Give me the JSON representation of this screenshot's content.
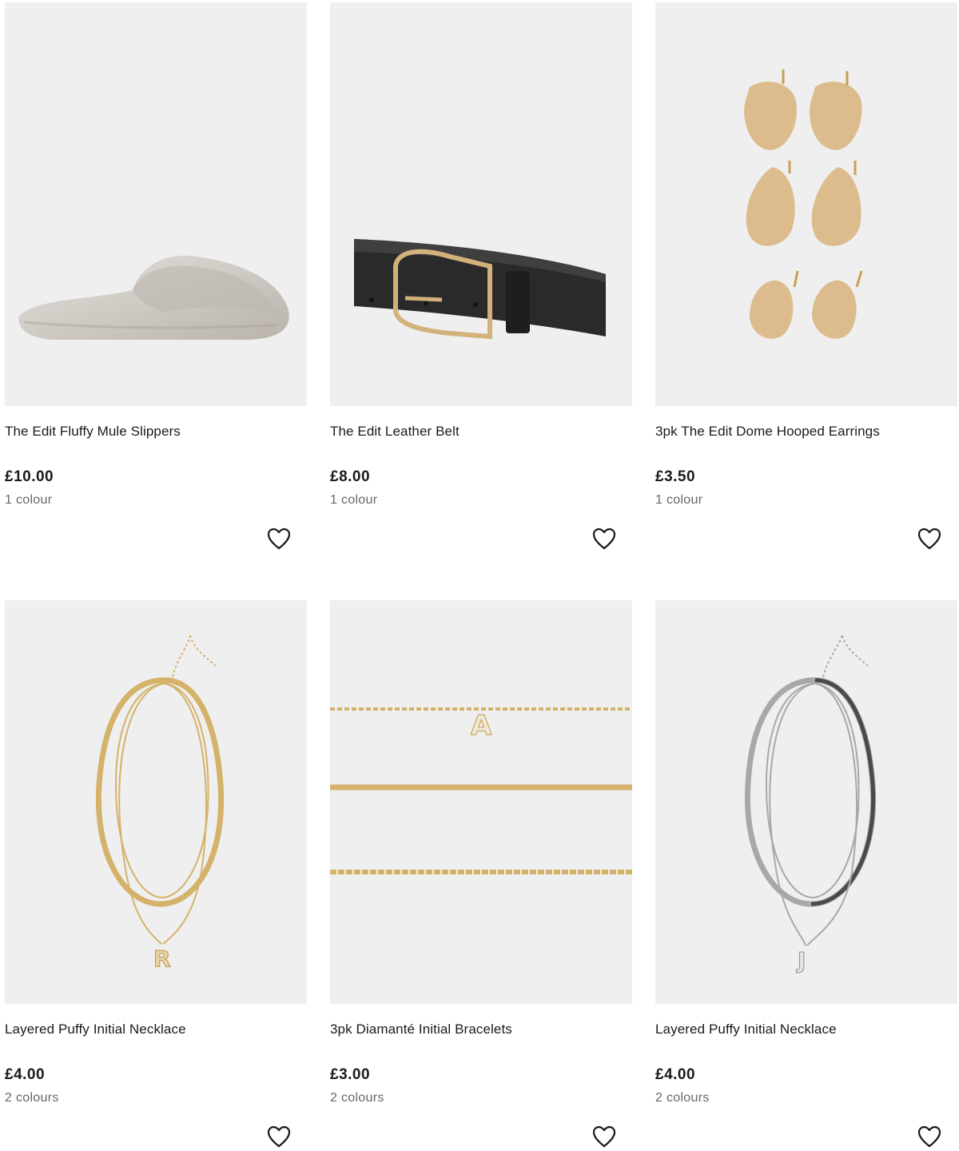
{
  "products": [
    {
      "name": "The Edit Fluffy Mule Slippers",
      "price": "£10.00",
      "colours": "1 colour",
      "image": "fluffy-slipper"
    },
    {
      "name": "The Edit Leather Belt",
      "price": "£8.00",
      "colours": "1 colour",
      "image": "leather-belt"
    },
    {
      "name": "3pk The Edit Dome Hooped Earrings",
      "price": "£3.50",
      "colours": "1 colour",
      "image": "dome-earrings"
    },
    {
      "name": "Layered Puffy Initial Necklace",
      "price": "£4.00",
      "colours": "2 colours",
      "image": "gold-necklace-r"
    },
    {
      "name": "3pk Diamanté Initial Bracelets",
      "price": "£3.00",
      "colours": "2 colours",
      "image": "gold-bracelets"
    },
    {
      "name": "Layered Puffy Initial Necklace",
      "price": "£4.00",
      "colours": "2 colours",
      "image": "silver-necklace-j"
    }
  ],
  "necklace_initials": {
    "gold": "R",
    "silver": "J",
    "bracelet": "A"
  },
  "icons": {
    "wishlist": "heart-outline-icon"
  },
  "colors": {
    "image_bg": "#efefef",
    "gold": "#d4b26a",
    "silver": "#a8a8a8",
    "price": "#1a1a1a",
    "muted": "#666666"
  }
}
